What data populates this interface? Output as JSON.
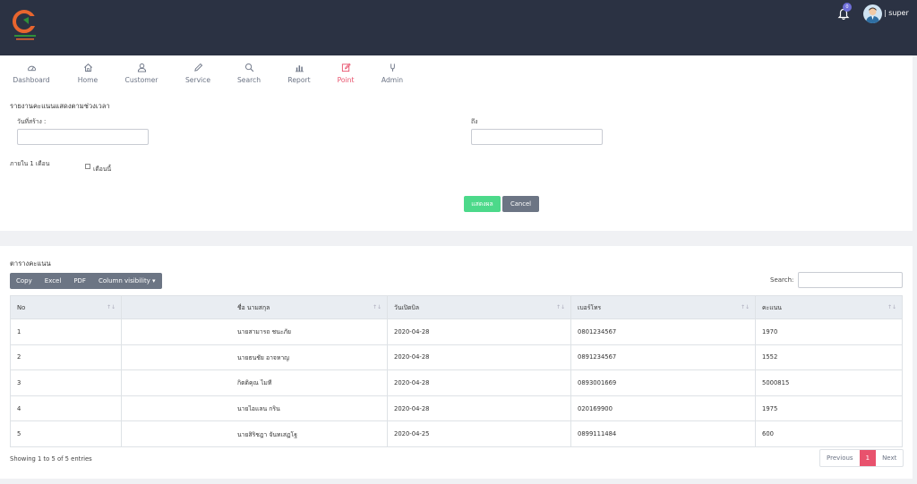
{
  "header": {
    "notification_count": "0",
    "user_name": "| super"
  },
  "nav": {
    "items": [
      {
        "label": "Dashboard",
        "icon": "dashboard-icon"
      },
      {
        "label": "Home",
        "icon": "home-icon"
      },
      {
        "label": "Customer",
        "icon": "user-icon"
      },
      {
        "label": "Service",
        "icon": "pencil-icon"
      },
      {
        "label": "Search",
        "icon": "search-icon"
      },
      {
        "label": "Report",
        "icon": "bar-chart-icon"
      },
      {
        "label": "Point",
        "icon": "edit-icon"
      },
      {
        "label": "Admin",
        "icon": "admin-icon"
      }
    ],
    "active_index": 6
  },
  "filter": {
    "title": "รายงานคะแนนแสดงตามช่วงเวลา",
    "created_label": "วันที่สร้าง :",
    "to_label": "ถึง",
    "created_value": "",
    "to_value": "",
    "within_label": "ภายใน 1 เดือน",
    "this_month_label": "เดือนนี้",
    "show_button": "แสดงผล",
    "cancel_button": "Cancel"
  },
  "table_card": {
    "title": "ตารางคะแนน",
    "buttons": [
      "Copy",
      "Excel",
      "PDF",
      "Column visibility ▾"
    ],
    "search_label": "Search:",
    "columns": [
      "No",
      "ชื่อ นามสกุล",
      "วันเปิดบิล",
      "เบอร์โทร",
      "คะแนน"
    ],
    "rows": [
      [
        "1",
        "นายสามารถ ชนะภัย",
        "2020-04-28",
        "0801234567",
        "1970"
      ],
      [
        "2",
        "นายธนชัย อาจหาญ",
        "2020-04-28",
        "0891234567",
        "1552"
      ],
      [
        "3",
        "กิตติคุณ ไมที",
        "2020-04-28",
        "0893001669",
        "5000815"
      ],
      [
        "4",
        "นายไอแลน กริน",
        "2020-04-28",
        "020169900",
        "1975"
      ],
      [
        "5",
        "นายสิริชฎา จันทเสฏโฐ",
        "2020-04-25",
        "0899111484",
        "600"
      ]
    ],
    "info": "Showing 1 to 5 of 5 entries",
    "pagination": {
      "previous": "Previous",
      "current": "1",
      "next": "Next"
    }
  },
  "colors": {
    "topbar": "#2b3243",
    "accent": "#e8526d",
    "success": "#4cd98a",
    "secondary": "#6c7584"
  }
}
